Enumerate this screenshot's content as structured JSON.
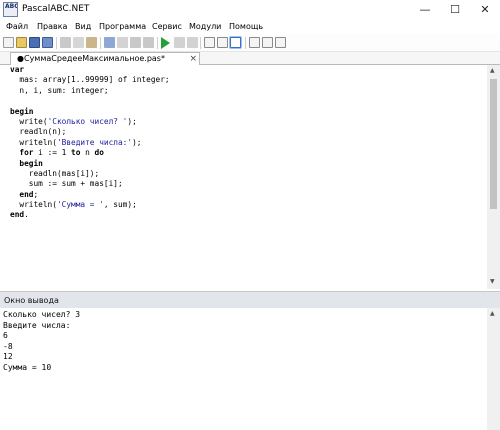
{
  "window": {
    "title": "PascalABC.NET",
    "icon_text": "ABC",
    "minimize": "—",
    "maximize": "☐",
    "close": "✕"
  },
  "menu": [
    "Файл",
    "Правка",
    "Вид",
    "Программа",
    "Сервис",
    "Модули",
    "Помощь"
  ],
  "tab": {
    "label": "●СуммаСредееМаксимальное.pas*",
    "close": "×"
  },
  "editor": {
    "lines": [
      [
        {
          "t": "var",
          "c": "kw"
        }
      ],
      [
        {
          "t": "  mas: array[1..99999] of integer;"
        }
      ],
      [
        {
          "t": "  n, i, sum: integer;"
        }
      ],
      [
        {
          "t": ""
        }
      ],
      [
        {
          "t": "begin",
          "c": "kw"
        }
      ],
      [
        {
          "t": "  write("
        },
        {
          "t": "'Сколько чисел? '",
          "c": "str"
        },
        {
          "t": ");"
        }
      ],
      [
        {
          "t": "  readln(n);"
        }
      ],
      [
        {
          "t": "  writeln("
        },
        {
          "t": "'Введите числа:'",
          "c": "str"
        },
        {
          "t": ");"
        }
      ],
      [
        {
          "t": "  for",
          "c": "kw"
        },
        {
          "t": " i := 1 "
        },
        {
          "t": "to",
          "c": "kw"
        },
        {
          "t": " n "
        },
        {
          "t": "do",
          "c": "kw"
        }
      ],
      [
        {
          "t": "  begin",
          "c": "kw"
        }
      ],
      [
        {
          "t": "    readln(mas[i]);"
        }
      ],
      [
        {
          "t": "    sum := sum + mas[i];"
        }
      ],
      [
        {
          "t": "  end",
          "c": "kw"
        },
        {
          "t": ";"
        }
      ],
      [
        {
          "t": "  writeln("
        },
        {
          "t": "'Сумма = '",
          "c": "str"
        },
        {
          "t": ", sum);"
        }
      ],
      [
        {
          "t": "end",
          "c": "kw"
        },
        {
          "t": "."
        }
      ]
    ]
  },
  "output": {
    "title": "Окно вывода",
    "lines": [
      "Сколько чисел? 3",
      "Введите числа:",
      "6",
      "-8",
      "12",
      "Сумма = 10"
    ]
  },
  "colors": {
    "string": "#1d1d9e",
    "output_header": "#e2e6ea"
  }
}
